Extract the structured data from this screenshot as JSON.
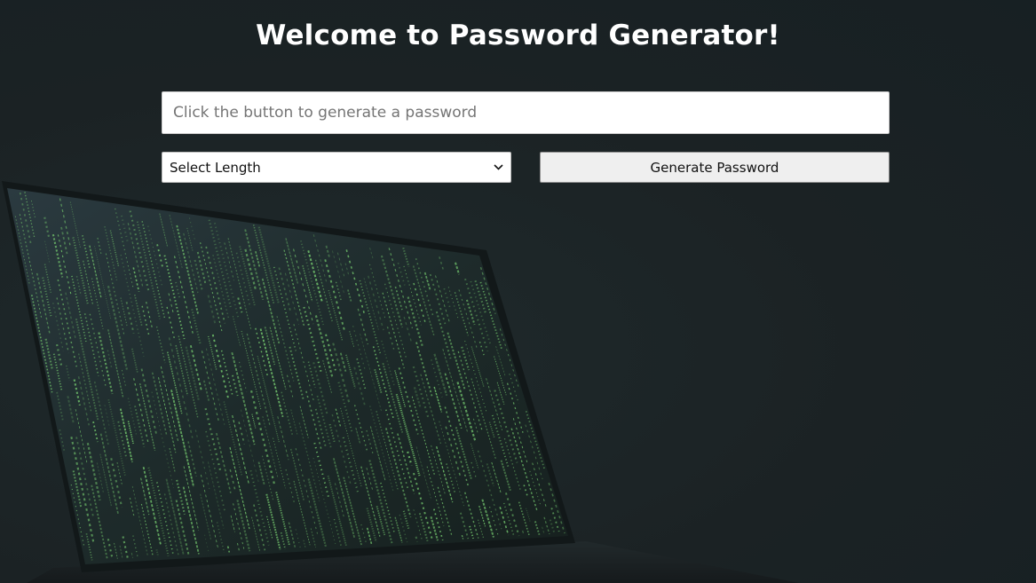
{
  "page": {
    "title": "Welcome to Password Generator!"
  },
  "password_field": {
    "placeholder": "Click the button to generate a password",
    "value": ""
  },
  "length_select": {
    "selected_label": "Select Length"
  },
  "generate_button": {
    "label": "Generate Password"
  },
  "background": {
    "image": "laptop-matrix-code",
    "base_color": "#1c2326",
    "code_color": "#6fbf6a"
  }
}
